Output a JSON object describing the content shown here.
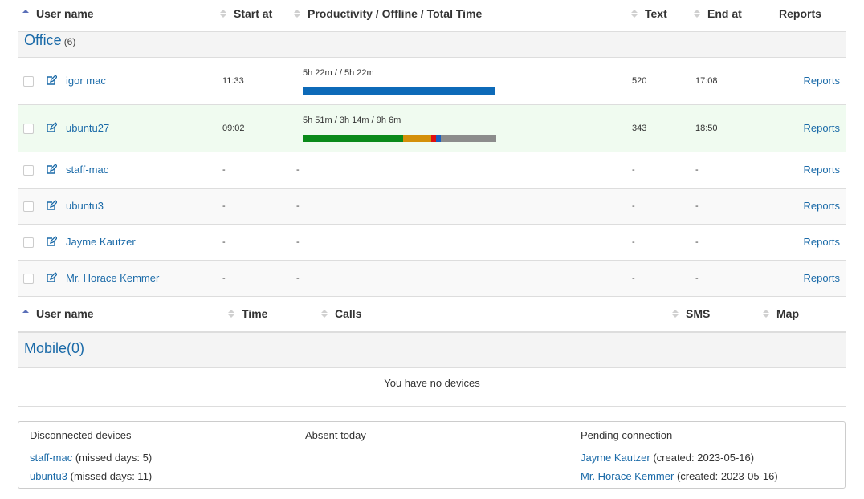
{
  "office_table": {
    "headers": {
      "user_name": "User name",
      "start_at": "Start at",
      "productivity": "Productivity / Offline / Total Time",
      "text": "Text",
      "end_at": "End at",
      "reports": "Reports"
    },
    "group_name": "Office",
    "group_count": "(6)",
    "rows": [
      {
        "name": "igor mac",
        "start": "11:33",
        "prod_text": "5h 22m /  / 5h 22m",
        "text": "520",
        "end": "17:08",
        "reports": "Reports",
        "bar": [
          {
            "color": "#0d6ab8",
            "fraction": 1.0
          }
        ]
      },
      {
        "name": "ubuntu27",
        "start": "09:02",
        "prod_text": "5h 51m / 3h 14m / 9h 6m",
        "text": "343",
        "end": "18:50",
        "reports": "Reports",
        "bar": [
          {
            "color": "#0a8a1a",
            "fraction": 0.643
          },
          {
            "color": "#d4900a",
            "fraction": 0.179
          },
          {
            "color": "#e01010",
            "fraction": 0.032
          },
          {
            "color": "#1a5fc0",
            "fraction": 0.032
          },
          {
            "color": "#8c8c8c",
            "fraction": 0.357
          }
        ]
      },
      {
        "name": "staff-mac",
        "start": "-",
        "prod_text": "-",
        "text": "-",
        "end": "-",
        "reports": "Reports"
      },
      {
        "name": "ubuntu3",
        "start": "-",
        "prod_text": "-",
        "text": "-",
        "end": "-",
        "reports": "Reports"
      },
      {
        "name": "Jayme Kautzer",
        "start": "-",
        "prod_text": "-",
        "text": "-",
        "end": "-",
        "reports": "Reports"
      },
      {
        "name": "Mr. Horace Kemmer",
        "start": "-",
        "prod_text": "-",
        "text": "-",
        "end": "-",
        "reports": "Reports"
      }
    ]
  },
  "mobile_table": {
    "headers": {
      "user_name": "User name",
      "time": "Time",
      "calls": "Calls",
      "sms": "SMS",
      "map": "Map"
    },
    "group_name": "Mobile",
    "group_count": "(0)",
    "empty_message": "You have no devices"
  },
  "summary": {
    "disconnected": {
      "title": "Disconnected devices",
      "items": [
        {
          "name": "staff-mac",
          "note": "(missed days: 5)"
        },
        {
          "name": "ubuntu3",
          "note": "(missed days: 11)"
        }
      ]
    },
    "absent": {
      "title": "Absent today"
    },
    "pending": {
      "title": "Pending connection",
      "items": [
        {
          "name": "Jayme Kautzer",
          "note": "(created: 2023-05-16)"
        },
        {
          "name": "Mr. Horace Kemmer",
          "note": "(created: 2023-05-16)"
        }
      ]
    }
  },
  "colors": {
    "link": "#1a6aa8",
    "highlight_row": "#f0fbf0",
    "productive": "#0a8a1a",
    "offline": "#d4900a",
    "total_bar": "#0d6ab8"
  },
  "icons": {
    "edit": "edit-icon",
    "sort": "sort-icon",
    "sort_asc": "sort-asc-icon"
  }
}
